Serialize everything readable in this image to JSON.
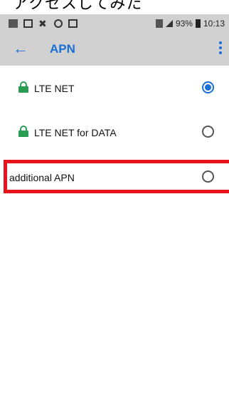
{
  "top_text": "アクセスしてみた",
  "status_bar": {
    "signal_text": "93%",
    "time": "10:13"
  },
  "app_bar": {
    "back_glyph": "←",
    "title": "APN"
  },
  "apn_list": [
    {
      "label": "LTE NET",
      "locked": true,
      "selected": true
    },
    {
      "label": "LTE NET for DATA",
      "locked": true,
      "selected": false
    },
    {
      "label": "additional APN",
      "locked": false,
      "selected": false
    }
  ],
  "colors": {
    "accent": "#1a6fd6",
    "lock": "#2a9d52",
    "highlight": "#e8141b",
    "bar_bg": "#d1d1d1"
  }
}
